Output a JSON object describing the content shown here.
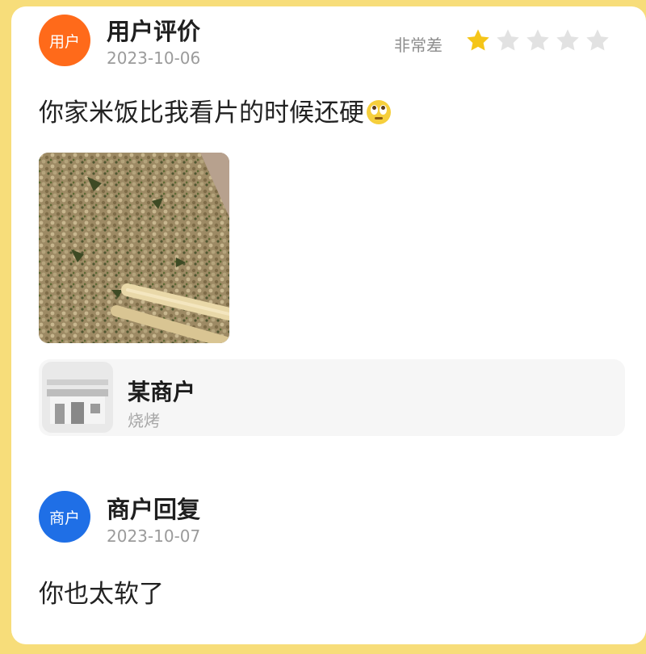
{
  "review": {
    "avatar_label": "用户",
    "avatar_color": "#ff6a1a",
    "author": "用户评价",
    "date": "2023-10-06",
    "rating_label": "非常差",
    "rating": 1,
    "rating_max": 5,
    "text": "你家米饭比我看片的时候还硬",
    "emoji": "rolling-eyes-emoji"
  },
  "merchant": {
    "name": "某商户",
    "category": "烧烤",
    "icon": "storefront-icon"
  },
  "reply": {
    "avatar_label": "商户",
    "avatar_color": "#1f6fe6",
    "author": "商户回复",
    "date": "2023-10-07",
    "text": "你也太软了"
  },
  "colors": {
    "background": "#f7dd7a",
    "star_active": "#f5c518",
    "star_inactive": "#e2e2e2"
  }
}
